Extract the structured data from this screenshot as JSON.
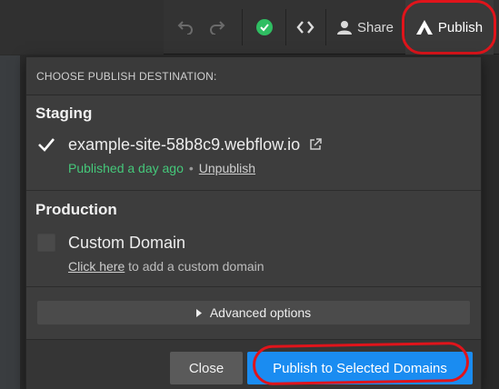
{
  "toolbar": {
    "undo_icon": "undo-icon",
    "redo_icon": "redo-icon",
    "status_icon": "check-circle-icon",
    "code_icon": "code-icon",
    "code_label": "‹›",
    "share_label": "Share",
    "publish_label": "Publish"
  },
  "dialog": {
    "header": "CHOOSE PUBLISH DESTINATION:",
    "staging": {
      "title": "Staging",
      "domain": "example-site-58b8c9.webflow.io",
      "checked": true,
      "status": "Published a day ago",
      "separator": "•",
      "unpublish": "Unpublish"
    },
    "production": {
      "title": "Production",
      "label": "Custom Domain",
      "checked": false,
      "link": "Click here",
      "hint": " to add a custom domain"
    },
    "advanced": "Advanced options",
    "close_label": "Close",
    "publish_label": "Publish to Selected Domains"
  },
  "colors": {
    "accent_blue": "#1a8cf1",
    "success_green": "#45c87a",
    "annotation_red": "#e0141b"
  }
}
